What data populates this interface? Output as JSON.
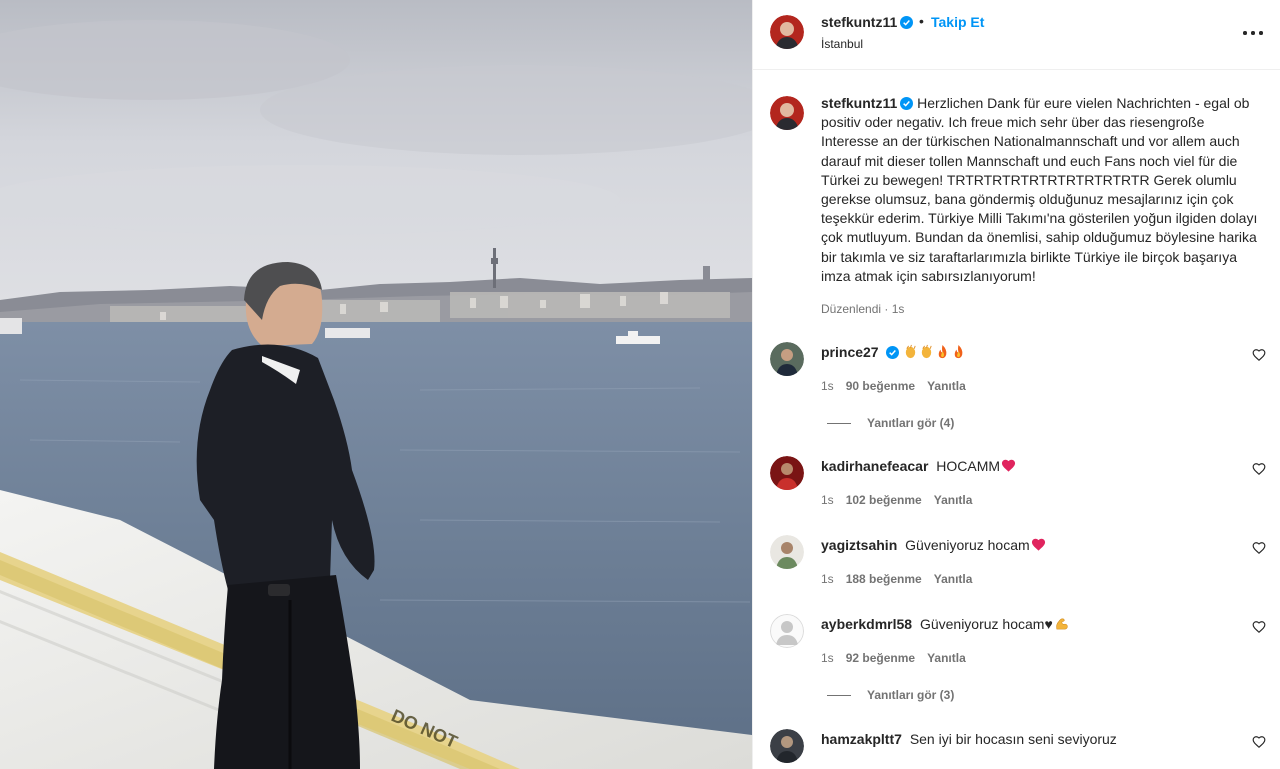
{
  "header": {
    "username": "stefkuntz11",
    "separator": "•",
    "follow_label": "Takip Et",
    "location": "İstanbul",
    "more_icon": "more-horizontal-icon"
  },
  "caption": {
    "username": "stefkuntz11",
    "text": "Herzlichen Dank für eure vielen Nachrichten - egal ob positiv oder negativ. Ich freue mich sehr über das riesengroße Interesse an der türkischen Nationalmannschaft und vor allem auch darauf mit dieser tollen Mannschaft und euch Fans noch viel für die Türkei zu bewegen! TRTRTRTRTRTRTRTRTRTRTR Gerek olumlu gerekse olumsuz, bana göndermiş olduğunuz mesajlarınız için çok teşekkür ederim. Türkiye Milli Takımı'na gösterilen yoğun ilgiden dolayı çok mutluyum. Bundan da önemlisi, sahip olduğumuz böylesine harika bir takımla ve siz taraftarlarımızla birlikte Türkiye ile birçok başarıya imza atmak için sabırsızlanıyorum!",
    "edited": "Düzenlendi",
    "time": "1s"
  },
  "comments": [
    {
      "username": "prince27",
      "verified": true,
      "text": "",
      "emoji": [
        "clap",
        "clap",
        "fire",
        "fire"
      ],
      "time": "1s",
      "likes": "90 beğenme",
      "reply": "Yanıtla",
      "view_replies": "Yanıtları gör (4)"
    },
    {
      "username": "kadirhanefeacar",
      "verified": false,
      "text": "HOCAMM",
      "emoji": [
        "red-heart"
      ],
      "time": "1s",
      "likes": "102 beğenme",
      "reply": "Yanıtla",
      "view_replies": ""
    },
    {
      "username": "yagiztsahin",
      "verified": false,
      "text": "Güveniyoruz hocam",
      "emoji": [
        "red-heart"
      ],
      "time": "1s",
      "likes": "188 beğenme",
      "reply": "Yanıtla",
      "view_replies": ""
    },
    {
      "username": "ayberkdmrl58",
      "verified": false,
      "text": "Güveniyoruz hocam♥",
      "emoji": [
        "flexed-biceps"
      ],
      "time": "1s",
      "likes": "92 beğenme",
      "reply": "Yanıtla",
      "view_replies": "Yanıtları gör (3)"
    },
    {
      "username": "hamzakpltt7",
      "verified": false,
      "text": "Sen iyi bir hocasın seni seviyoruz",
      "emoji": [],
      "time": "",
      "likes": "",
      "reply": "",
      "view_replies": ""
    }
  ],
  "colors": {
    "accent": "#0095f6",
    "text": "#262626",
    "secondary": "#737373"
  }
}
